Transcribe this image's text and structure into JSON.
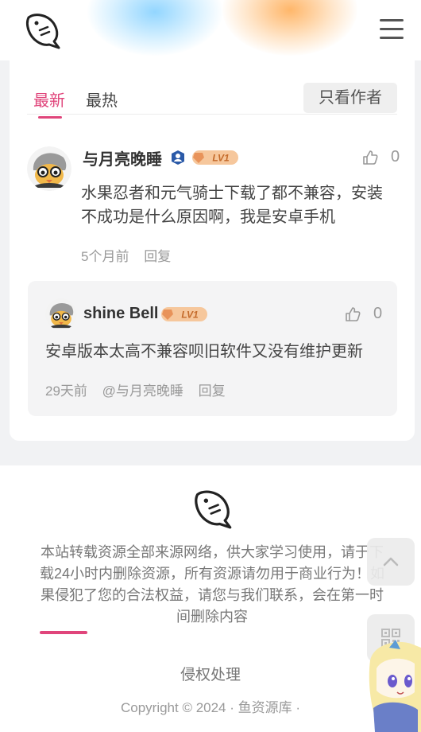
{
  "tabs": {
    "latest": "最新",
    "hottest": "最热",
    "author_only": "只看作者"
  },
  "comment": {
    "username": "与月亮晚睡",
    "level": "LV1",
    "likes": "0",
    "text": "水果忍者和元气骑士下载了都不兼容，安装不成功是什么原因啊，我是安卓手机",
    "time": "5个月前",
    "reply_label": "回复"
  },
  "reply": {
    "username": "shine Bell",
    "level": "LV1",
    "likes": "0",
    "text": "安卓版本太高不兼容呗旧软件又没有维护更新",
    "time": "29天前",
    "mention": "@与月亮晚睡",
    "reply_label": "回复"
  },
  "footer": {
    "notice": "本站转载资源全部来源网络，供大家学习使用，请于下载24小时内删除资源，所有资源请勿用于商业行为！如果侵犯了您的合法权益，请您与我们联系，会在第一时间删除内容",
    "infringement_label": "侵权处理",
    "copyright": "Copyright © 2024 · 鱼资源库 ·"
  },
  "icons": {
    "logo": "fish-logo-icon",
    "menu": "hamburger-menu-icon",
    "like": "thumbs-up-icon",
    "badge": "user-badge-icon",
    "scroll_top": "chevron-up-icon",
    "qr": "qr-code-icon"
  },
  "colors": {
    "accent": "#e0457b",
    "level_badge": "#e8935a"
  }
}
